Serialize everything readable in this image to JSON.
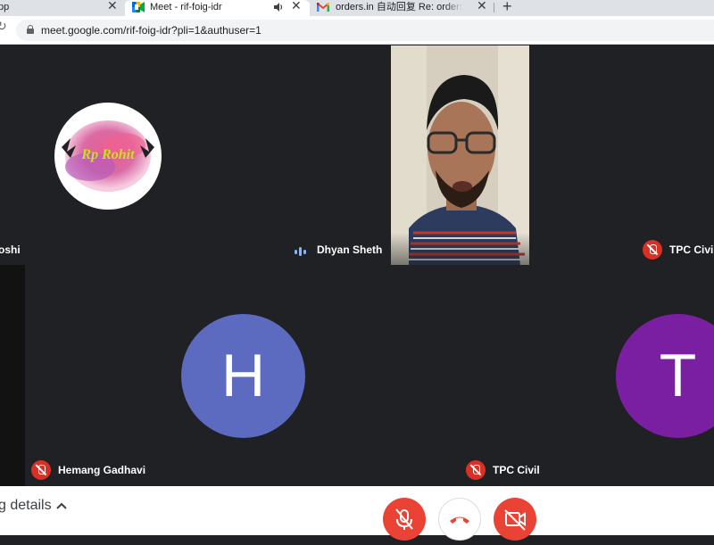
{
  "browser": {
    "tabs": [
      {
        "title": "pp",
        "close": "✕"
      },
      {
        "title": "Meet - rif-foig-idr",
        "close": "✕",
        "active": true
      },
      {
        "title": "orders.in 自动回复 Re: orders.in",
        "close": "✕"
      }
    ],
    "new_tab": "+",
    "url": "meet.google.com/rif-foig-idr?pli=1&authuser=1"
  },
  "meeting": {
    "participants": [
      {
        "name": "oshi",
        "muted": false
      },
      {
        "name": "Dhyan Sheth",
        "speaking": true
      },
      {
        "name": "TPC Civil",
        "muted": true
      },
      {
        "name": "Hemang Gadhavi",
        "muted": true,
        "initial": "H",
        "avatar_color": "#5c6bc0"
      },
      {
        "name": "TPC Civil",
        "muted": true,
        "initial": "T",
        "avatar_color": "#7b1fa2"
      }
    ],
    "logo_text": "Rp Rohit"
  },
  "controls": {
    "details_label": "g details",
    "mic_icon": "mic-off-icon",
    "hangup_icon": "call-end-icon",
    "camera_icon": "videocam-off-icon"
  },
  "colors": {
    "background": "#202124",
    "tile": "#3c4043",
    "danger": "#ea4335",
    "speaking": "#8ab4f8"
  }
}
